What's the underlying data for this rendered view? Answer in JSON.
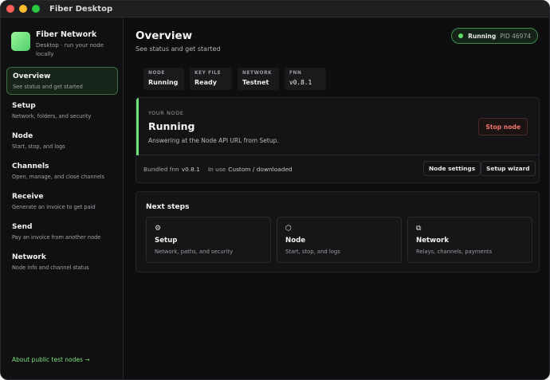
{
  "window": {
    "title": "Fiber Desktop"
  },
  "brand": {
    "title": "Fiber Network",
    "subtitle": "Desktop · run your node locally"
  },
  "sidebar": {
    "items": [
      {
        "label": "Overview",
        "desc": "See status and get started",
        "active": true
      },
      {
        "label": "Setup",
        "desc": "Network, folders, and security"
      },
      {
        "label": "Node",
        "desc": "Start, stop, and logs"
      },
      {
        "label": "Channels",
        "desc": "Open, manage, and close channels"
      },
      {
        "label": "Receive",
        "desc": "Generate an invoice to get paid"
      },
      {
        "label": "Send",
        "desc": "Pay an invoice from another node"
      },
      {
        "label": "Network",
        "desc": "Node info and channel status"
      }
    ],
    "about_link": "About public test nodes →"
  },
  "header": {
    "title": "Overview",
    "subtitle": "See status and get started",
    "status_label": "Running",
    "status_pid": "PID 46974"
  },
  "stats": [
    {
      "key": "NODE",
      "value": "Running"
    },
    {
      "key": "KEY FILE",
      "value": "Ready"
    },
    {
      "key": "NETWORK",
      "value": "Testnet"
    },
    {
      "key": "FNN",
      "value": "v0.8.1"
    }
  ],
  "node_card": {
    "kicker": "YOUR NODE",
    "status": "Running",
    "desc": "Answering at the Node API URL from Setup.",
    "stop_label": "Stop node",
    "bundled_label": "Bundled fnn",
    "bundled_value": "v0.8.1",
    "in_use_label": "In use",
    "in_use_value": "Custom / downloaded",
    "settings_label": "Node settings",
    "wizard_label": "Setup wizard"
  },
  "next_steps": {
    "title": "Next steps",
    "tiles": [
      {
        "icon": "⚙",
        "title": "Setup",
        "desc": "Network, paths, and security"
      },
      {
        "icon": "⬡",
        "title": "Node",
        "desc": "Start, stop, and logs"
      },
      {
        "icon": "⧉",
        "title": "Network",
        "desc": "Relays, channels, payments"
      }
    ]
  },
  "colors": {
    "accent": "#5fdc6a",
    "danger": "#f0736d",
    "background": "#0e0e10"
  }
}
